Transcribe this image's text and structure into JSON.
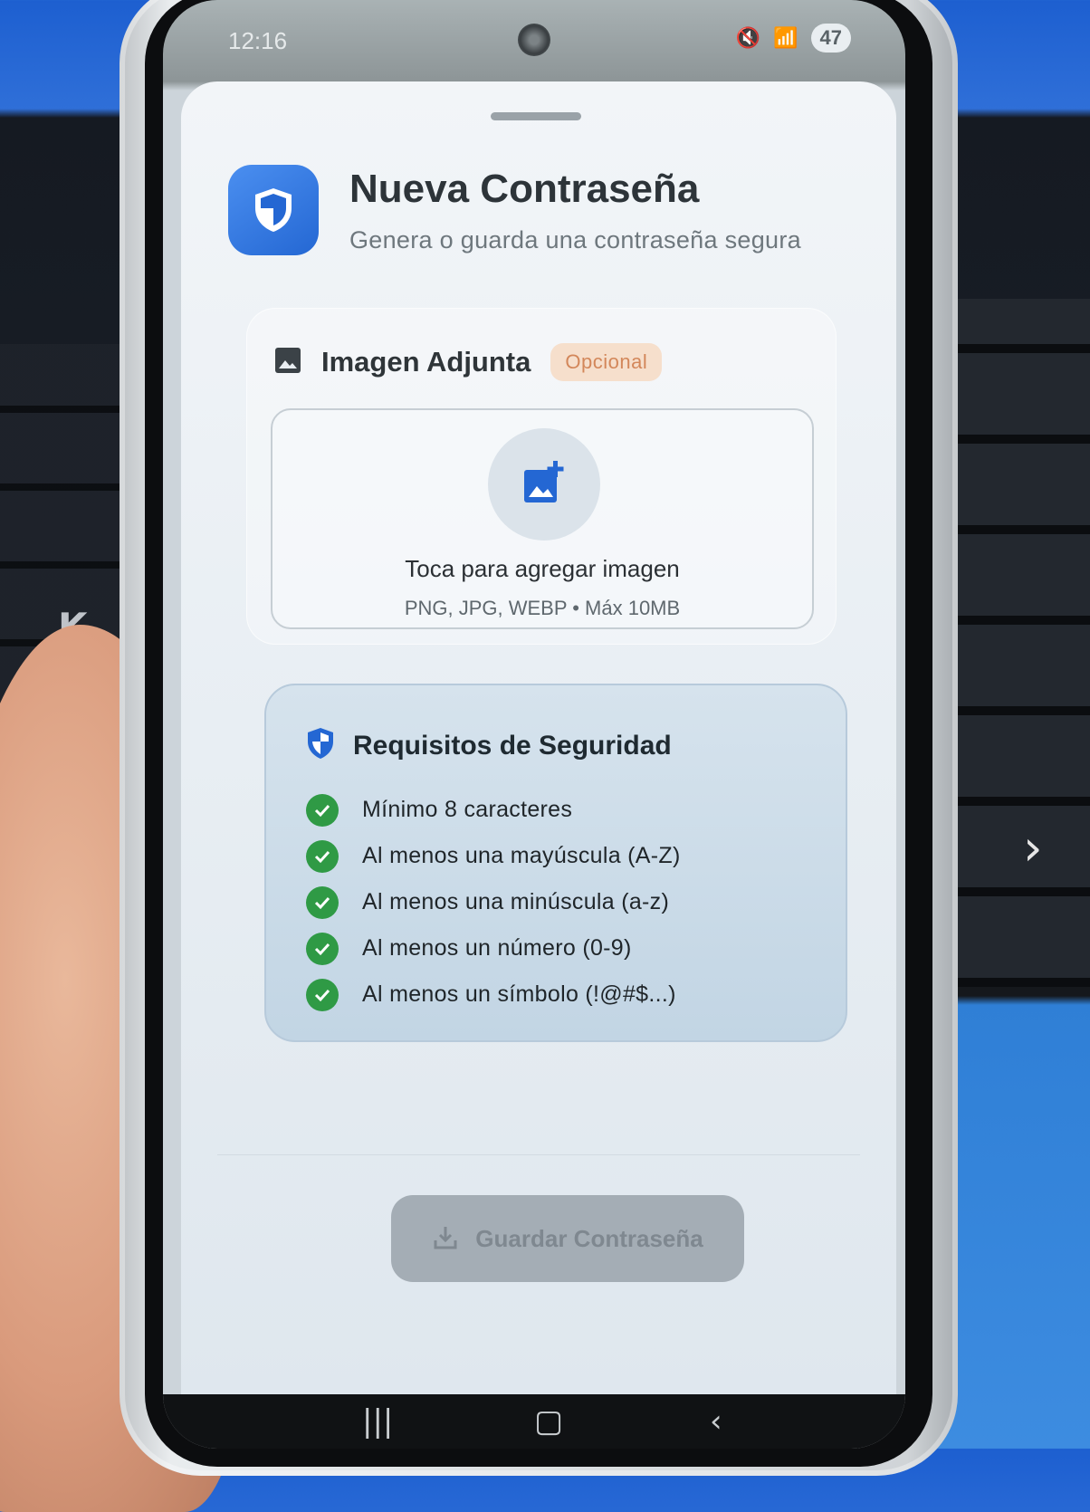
{
  "status_bar": {
    "time": "12:16",
    "battery": "47"
  },
  "header": {
    "title": "Nueva Contraseña",
    "subtitle": "Genera o guarda una contraseña segura"
  },
  "image_section": {
    "title": "Imagen Adjunta",
    "badge": "Opcional",
    "upload_title": "Toca para agregar imagen",
    "upload_hint": "PNG, JPG, WEBP • Máx 10MB"
  },
  "security": {
    "title": "Requisitos de Seguridad",
    "requirements": [
      {
        "label": "Mínimo 8 caracteres",
        "met": true
      },
      {
        "label": "Al menos una mayúscula (A-Z)",
        "met": true
      },
      {
        "label": "Al menos una minúscula (a-z)",
        "met": true
      },
      {
        "label": "Al menos un número (0-9)",
        "met": true
      },
      {
        "label": "Al menos un símbolo (!@#$...)",
        "met": true
      }
    ]
  },
  "actions": {
    "save_label": "Guardar Contraseña",
    "save_enabled": false
  },
  "background": {
    "keyboard_key": "K",
    "arrow_key": "›"
  },
  "colors": {
    "accent": "#2467d3",
    "check": "#2f9a45",
    "badge_text": "#d3875a",
    "button_disabled": "#a4adb5"
  }
}
